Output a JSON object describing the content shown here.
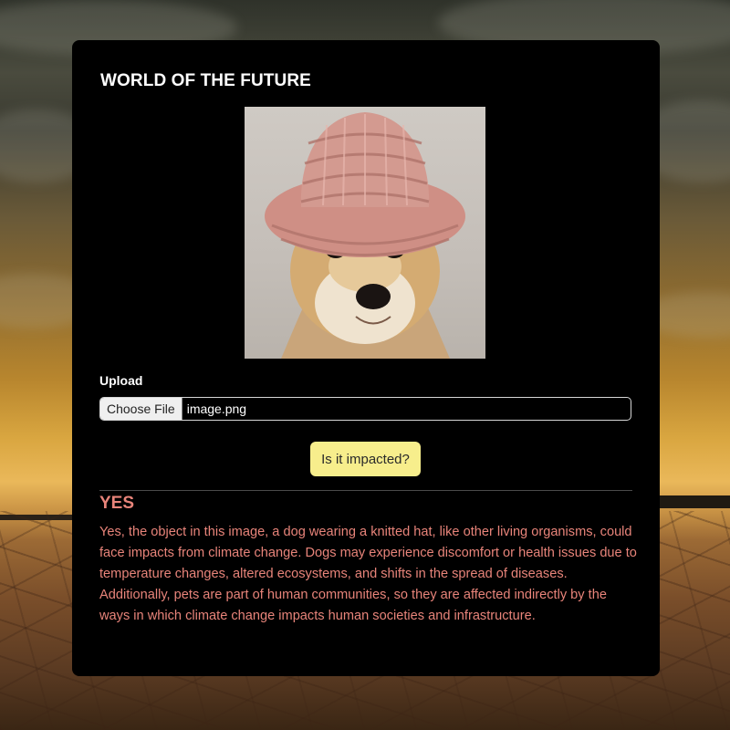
{
  "app": {
    "title": "WORLD OF THE FUTURE"
  },
  "image_preview": {
    "subject": "dog-wearing-knitted-hat"
  },
  "upload": {
    "label": "Upload",
    "button_label": "Choose File",
    "file_name": "image.png"
  },
  "action": {
    "label": "Is it impacted?"
  },
  "result": {
    "verdict": "YES",
    "text": "Yes, the object in this image, a dog wearing a knitted hat, like other living organisms, could face impacts from climate change. Dogs may experience discomfort or health issues due to temperature changes, altered ecosystems, and shifts in the spread of diseases. Additionally, pets are part of human communities, so they are affected indirectly by the ways in which climate change impacts human societies and infrastructure."
  },
  "colors": {
    "card_bg": "#000000",
    "button_bg": "#f7ee8c",
    "result_text": "#e8847a",
    "title_text": "#ffffff"
  }
}
